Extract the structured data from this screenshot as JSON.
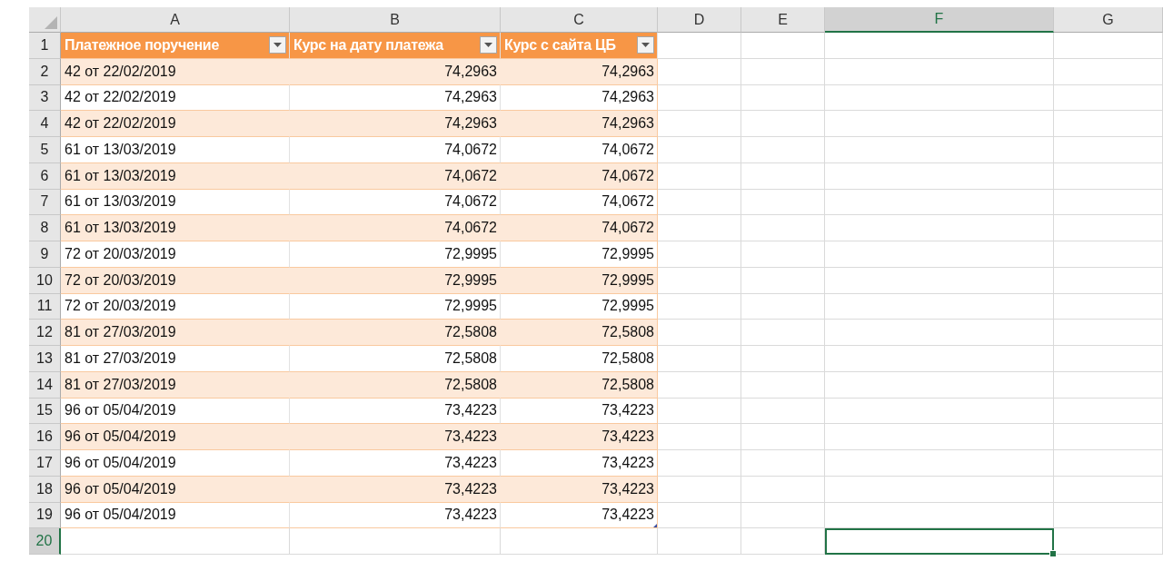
{
  "columns": [
    {
      "label": "A",
      "selected": false
    },
    {
      "label": "B",
      "selected": false
    },
    {
      "label": "C",
      "selected": false
    },
    {
      "label": "D",
      "selected": false
    },
    {
      "label": "E",
      "selected": false
    },
    {
      "label": "F",
      "selected": true
    },
    {
      "label": "G",
      "selected": false
    }
  ],
  "table": {
    "header_row": "1",
    "header_row_selected": false,
    "headers": [
      "Платежное поручение",
      "Курс на дату платежа",
      "Курс с сайта ЦБ"
    ],
    "rows": [
      {
        "number": "2",
        "selected": false,
        "cells": [
          "42 от 22/02/2019",
          "74,2963",
          "74,2963"
        ]
      },
      {
        "number": "3",
        "selected": false,
        "cells": [
          "42 от 22/02/2019",
          "74,2963",
          "74,2963"
        ]
      },
      {
        "number": "4",
        "selected": false,
        "cells": [
          "42 от 22/02/2019",
          "74,2963",
          "74,2963"
        ]
      },
      {
        "number": "5",
        "selected": false,
        "cells": [
          "61 от 13/03/2019",
          "74,0672",
          "74,0672"
        ]
      },
      {
        "number": "6",
        "selected": false,
        "cells": [
          "61 от 13/03/2019",
          "74,0672",
          "74,0672"
        ]
      },
      {
        "number": "7",
        "selected": false,
        "cells": [
          "61 от 13/03/2019",
          "74,0672",
          "74,0672"
        ]
      },
      {
        "number": "8",
        "selected": false,
        "cells": [
          "61 от 13/03/2019",
          "74,0672",
          "74,0672"
        ]
      },
      {
        "number": "9",
        "selected": false,
        "cells": [
          "72 от 20/03/2019",
          "72,9995",
          "72,9995"
        ]
      },
      {
        "number": "10",
        "selected": false,
        "cells": [
          "72 от 20/03/2019",
          "72,9995",
          "72,9995"
        ]
      },
      {
        "number": "11",
        "selected": false,
        "cells": [
          "72 от 20/03/2019",
          "72,9995",
          "72,9995"
        ]
      },
      {
        "number": "12",
        "selected": false,
        "cells": [
          "81 от 27/03/2019",
          "72,5808",
          "72,5808"
        ]
      },
      {
        "number": "13",
        "selected": false,
        "cells": [
          "81 от 27/03/2019",
          "72,5808",
          "72,5808"
        ]
      },
      {
        "number": "14",
        "selected": false,
        "cells": [
          "81 от 27/03/2019",
          "72,5808",
          "72,5808"
        ]
      },
      {
        "number": "15",
        "selected": false,
        "cells": [
          "96 от 05/04/2019",
          "73,4223",
          "73,4223"
        ]
      },
      {
        "number": "16",
        "selected": false,
        "cells": [
          "96 от 05/04/2019",
          "73,4223",
          "73,4223"
        ]
      },
      {
        "number": "17",
        "selected": false,
        "cells": [
          "96 от 05/04/2019",
          "73,4223",
          "73,4223"
        ]
      },
      {
        "number": "18",
        "selected": false,
        "cells": [
          "96 от 05/04/2019",
          "73,4223",
          "73,4223"
        ]
      },
      {
        "number": "19",
        "selected": false,
        "cells": [
          "96 от 05/04/2019",
          "73,4223",
          "73,4223"
        ]
      }
    ]
  },
  "empty_rows": [
    {
      "number": "20",
      "selected": true
    }
  ]
}
